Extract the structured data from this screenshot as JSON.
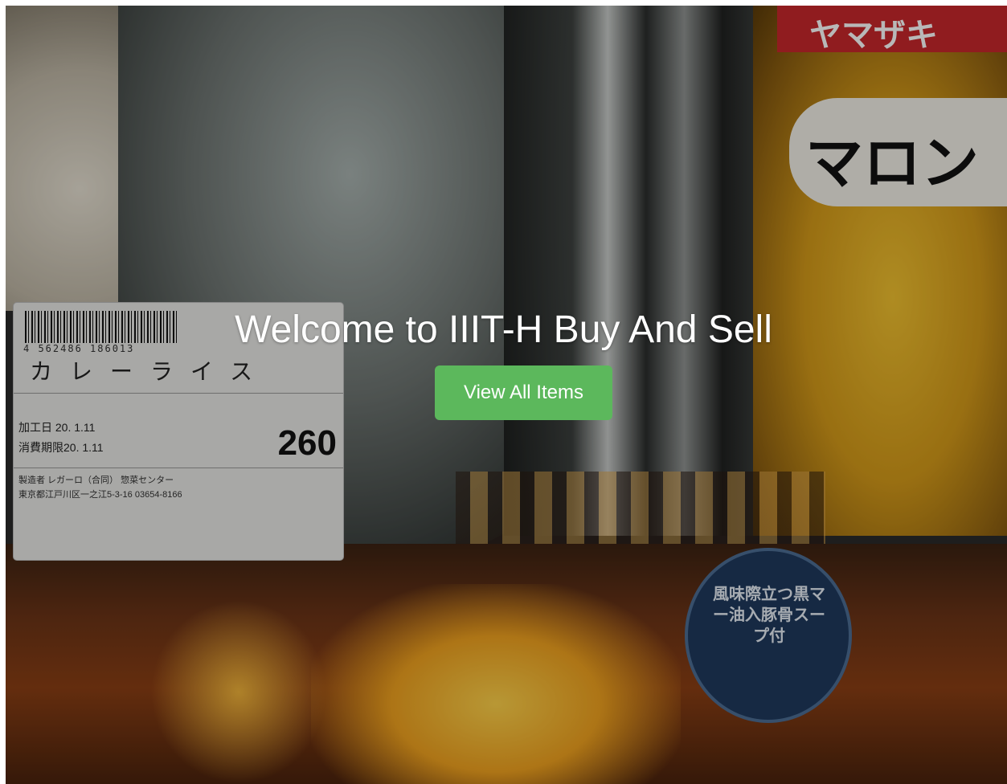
{
  "hero": {
    "title": "Welcome to IIIT-H Buy And Sell",
    "cta_label": "View All Items"
  },
  "background_photo": {
    "label_barcode_number": "4 562486 186013",
    "label_product_name": "カレーライス",
    "label_notice": "加工日 20. 1.11",
    "label_expiry": "消費期限20. 1.11",
    "label_price": "260",
    "label_maker": "製造者 レガーロ（合同） 惣菜センター",
    "label_address": "東京都江戸川区一之江5-3-16 03654-8166",
    "bread_brand": "ヤマザキ",
    "bread_name": "マロン",
    "seal_text": "風味際立つ黒マー油入豚骨スープ付"
  },
  "colors": {
    "cta_background": "#5cb85c",
    "title_color": "#ffffff"
  }
}
